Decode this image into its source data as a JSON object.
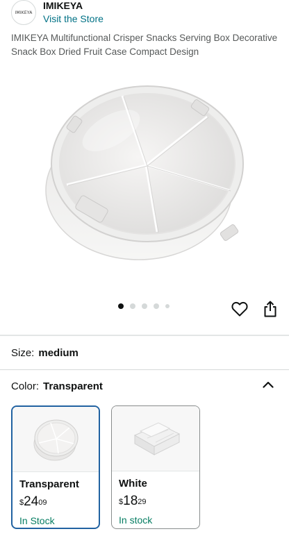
{
  "brand": {
    "logo_text": "IMIKEYA",
    "name": "IMIKEYA",
    "store_link": "Visit the Store"
  },
  "product": {
    "title": "IMIKEYA Multifunctional Crisper Snacks Serving Box Decorative Snack Box Dried Fruit Case Compact Design",
    "image_icon": "round-crisper-box-photo",
    "carousel": {
      "active_index": 0,
      "total": 5
    }
  },
  "actions": {
    "wishlist_icon": "heart-icon",
    "share_icon": "share-icon"
  },
  "size": {
    "label": "Size:",
    "value": "medium"
  },
  "color": {
    "label": "Color:",
    "value": "Transparent",
    "options": [
      {
        "name": "Transparent",
        "price_symbol": "$",
        "price_whole": "24",
        "price_fraction": "09",
        "stock": "In Stock",
        "selected": true
      },
      {
        "name": "White",
        "price_symbol": "$",
        "price_whole": "18",
        "price_fraction": "29",
        "stock": "In stock",
        "selected": false
      }
    ]
  },
  "colors": {
    "link": "#007185",
    "stock_green": "#067d62",
    "selected_border": "#2162a1"
  }
}
